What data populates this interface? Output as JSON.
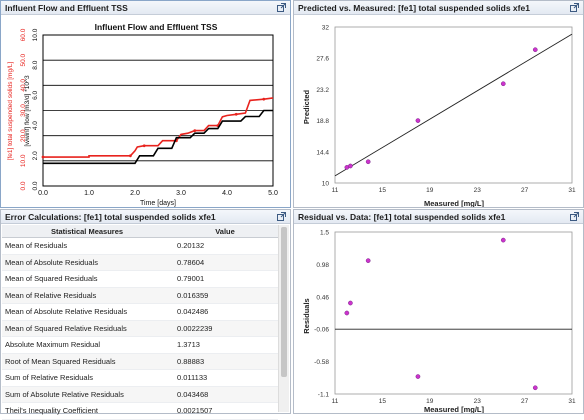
{
  "panels": {
    "flow": {
      "header": "Influent Flow and Effluent TSS",
      "chart_title": "Influent Flow and Effluent TSS",
      "xlabel": "Time [days]",
      "ylabel_left": "[fe1] total suspended solids [mg/L]",
      "ylabel_right": "[wwinf] flow [m3/d] *10^3"
    },
    "pvm": {
      "header": "Predicted vs. Measured: [fe1] total suspended solids xfe1"
    },
    "err": {
      "header": "Error Calculations: [fe1] total suspended solids xfe1"
    },
    "res": {
      "header": "Residual vs. Data: [fe1] total suspended solids xfe1"
    }
  },
  "error_table": {
    "columns": [
      "Statistical Measures",
      "Value"
    ],
    "rows": [
      [
        "Mean of Residuals",
        "0.20132"
      ],
      [
        "Mean of Absolute Residuals",
        "0.78604"
      ],
      [
        "Mean of Squared Residuals",
        "0.79001"
      ],
      [
        "Mean of Relative Residuals",
        "0.016359"
      ],
      [
        "Mean of Absolute Relative Residuals",
        "0.042486"
      ],
      [
        "Mean of Squared Relative Residuals",
        "0.0022239"
      ],
      [
        "Absolute Maximum Residual",
        "1.3713"
      ],
      [
        "Root of Mean Squared Residuals",
        "0.88883"
      ],
      [
        "Sum of Relative Residuals",
        "0.011133"
      ],
      [
        "Sum of Absolute Relative Residuals",
        "0.043468"
      ],
      [
        "Theil's Inequality Coefficient",
        "0.0021507"
      ]
    ]
  },
  "colors": {
    "tss": "#e8231e",
    "flow": "#000000",
    "points": "#cc33cc",
    "fit": "#222222"
  },
  "chart_data": [
    {
      "type": "line",
      "title": "Influent Flow and Effluent TSS",
      "xlabel": "Time [days]",
      "ylabel": "[fe1] total suspended solids [mg/L]",
      "ylabel_right": "[wwinf] flow [m3/d] *10^3",
      "xlim": [
        0,
        5
      ],
      "x_ticks": [
        "0.0",
        "1.0",
        "2.0",
        "3.0",
        "4.0",
        "5.0"
      ],
      "ylim_left": [
        0,
        60
      ],
      "y_ticks_left": [
        "0.0",
        "10.0",
        "20.0",
        "30.0",
        "40.0",
        "50.0",
        "60.0"
      ],
      "ylim_right": [
        0,
        10
      ],
      "y_ticks_right": [
        "0.0",
        "2.0",
        "4.0",
        "6.0",
        "8.0",
        "10.0"
      ],
      "series": [
        {
          "axis": "left",
          "color": "#e8231e",
          "x": [
            0,
            1.0,
            1.0,
            1.9,
            2.0,
            2.05,
            2.2,
            2.5,
            2.6,
            2.9,
            3.0,
            3.15,
            3.3,
            3.5,
            3.6,
            3.8,
            3.9,
            4.0,
            4.2,
            4.4,
            4.5,
            4.8,
            5.0
          ],
          "y": [
            11.5,
            11.5,
            12,
            12,
            14,
            15.5,
            16,
            16,
            18,
            18,
            20.5,
            21,
            22,
            22,
            24,
            24,
            27.5,
            28,
            28.5,
            29,
            34,
            34.5,
            35
          ]
        },
        {
          "axis": "right",
          "color": "#000000",
          "x": [
            0,
            2.0,
            2.1,
            2.4,
            2.5,
            2.8,
            2.9,
            3.2,
            3.3,
            3.5,
            3.6,
            3.8,
            3.9,
            4.3,
            4.4,
            4.7,
            4.8,
            5.0
          ],
          "y": [
            1.5,
            1.5,
            2.0,
            2.0,
            2.5,
            2.5,
            3.2,
            3.2,
            3.5,
            3.5,
            3.8,
            3.8,
            4.3,
            4.3,
            4.6,
            4.6,
            5.0,
            5.0
          ]
        }
      ]
    },
    {
      "type": "scatter",
      "xlabel": "Measured [mg/L]",
      "ylabel": "Predicted",
      "xlim": [
        11,
        31
      ],
      "x_ticks": [
        "11",
        "15",
        "19",
        "23",
        "27",
        "31"
      ],
      "ylim": [
        10,
        32
      ],
      "y_ticks": [
        "10",
        "14.4",
        "18.8",
        "23.2",
        "27.6",
        "32"
      ],
      "points": [
        [
          12.0,
          12.2
        ],
        [
          12.3,
          12.4
        ],
        [
          13.8,
          13.0
        ],
        [
          18.0,
          18.8
        ],
        [
          25.2,
          24.0
        ],
        [
          27.9,
          28.8
        ]
      ],
      "fit_line": [
        [
          11,
          11
        ],
        [
          31,
          31
        ]
      ]
    },
    {
      "type": "scatter",
      "xlabel": "Measured [mg/L]",
      "ylabel": "Residuals",
      "xlim": [
        11,
        31
      ],
      "x_ticks": [
        "11",
        "15",
        "19",
        "23",
        "27",
        "31"
      ],
      "ylim": [
        -1.1,
        1.5
      ],
      "y_ticks": [
        "-1.1",
        "-0.58",
        "-0.06",
        "0.46",
        "0.98",
        "1.5"
      ],
      "zero_line": -0.06,
      "points": [
        [
          12.0,
          0.2
        ],
        [
          12.3,
          0.36
        ],
        [
          13.8,
          1.04
        ],
        [
          18.0,
          -0.82
        ],
        [
          25.2,
          1.37
        ],
        [
          27.9,
          -1.0
        ]
      ]
    }
  ]
}
